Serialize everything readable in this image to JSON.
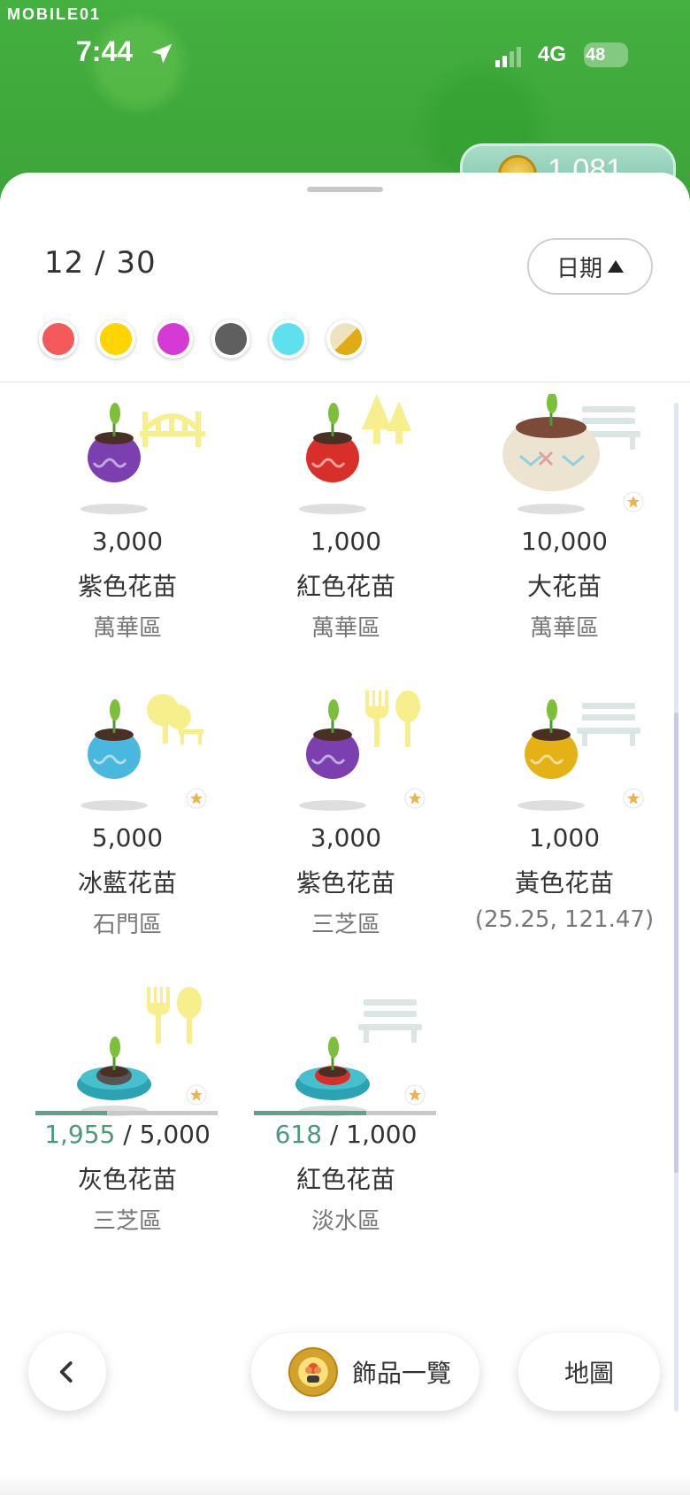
{
  "watermark": "MOBILE01",
  "status_bar": {
    "time": "7:44",
    "network": "4G",
    "battery": "48"
  },
  "coins": {
    "value": "1,081"
  },
  "header": {
    "count": "12 / 30",
    "sort_label": "日期"
  },
  "color_filters": [
    {
      "name": "red",
      "color": "#f45a5a"
    },
    {
      "name": "yellow",
      "color": "#ffd400"
    },
    {
      "name": "magenta",
      "color": "#d63ad4"
    },
    {
      "name": "gray",
      "color": "#5f5f5f"
    },
    {
      "name": "cyan",
      "color": "#5ee0ee"
    },
    {
      "name": "split",
      "color": "#e7c66a"
    }
  ],
  "items": [
    {
      "value": "3,000",
      "name": "紫色花苗",
      "area": "萬華區",
      "pot": "#7b3fb0",
      "deco": "bridge",
      "star": false
    },
    {
      "value": "1,000",
      "name": "紅色花苗",
      "area": "萬華區",
      "pot": "#d92f2a",
      "deco": "trees",
      "star": false
    },
    {
      "value": "10,000",
      "name": "大花苗",
      "area": "萬華區",
      "pot": "#ece4d0",
      "deco": "bench",
      "star": true
    },
    {
      "value": "5,000",
      "name": "冰藍花苗",
      "area": "石門區",
      "pot": "#4ab8de",
      "deco": "park",
      "star": true
    },
    {
      "value": "3,000",
      "name": "紫色花苗",
      "area": "三芝區",
      "pot": "#7b3fb0",
      "deco": "food",
      "star": true
    },
    {
      "value": "1,000",
      "name": "黃色花苗",
      "area": "(25.25, 121.47)",
      "pot": "#e5b215",
      "deco": "bench",
      "star": true
    },
    {
      "progress": "1,955",
      "total": "/ 5,000",
      "name": "灰色花苗",
      "area": "三芝區",
      "pot": "#555555",
      "deco": "food",
      "star": true,
      "fraction": 0.391
    },
    {
      "progress": "618",
      "total": "/ 1,000",
      "name": "紅色花苗",
      "area": "淡水區",
      "pot": "#d92f2a",
      "deco": "bench",
      "star": true,
      "fraction": 0.618
    }
  ],
  "footer": {
    "decorations_label": "飾品一覽",
    "map_label": "地圖"
  }
}
